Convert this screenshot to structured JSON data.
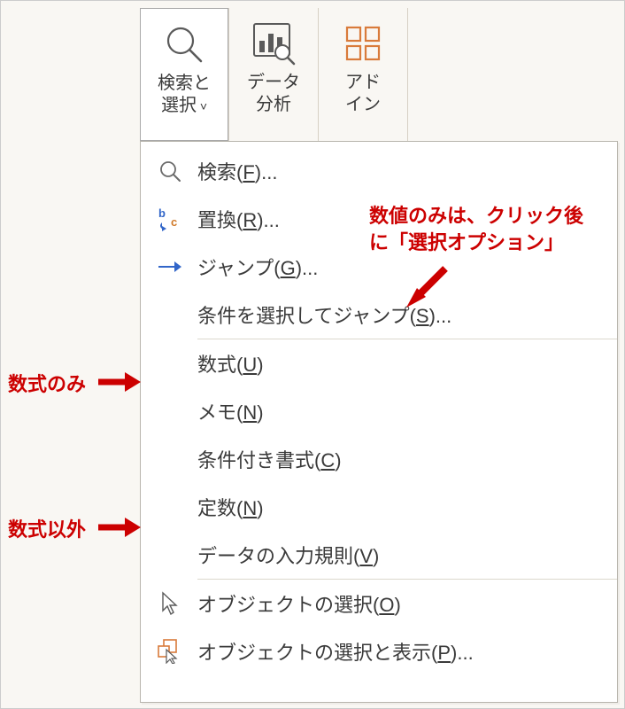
{
  "ribbon": {
    "find_select": {
      "line1": "検索と",
      "line2": "選択"
    },
    "data_analysis": {
      "line1": "データ",
      "line2": "分析"
    },
    "addins": {
      "line1": "アド",
      "line2": "イン"
    }
  },
  "menu": {
    "find": "検索(",
    "find_key": "F",
    "find_suffix": ")...",
    "replace": "置換(",
    "replace_key": "R",
    "replace_suffix": ")...",
    "goto": "ジャンプ(",
    "goto_key": "G",
    "goto_suffix": ")...",
    "goto_special": "条件を選択してジャンプ(",
    "goto_special_key": "S",
    "goto_special_suffix": ")...",
    "formulas": "数式(",
    "formulas_key": "U",
    "formulas_suffix": ")",
    "notes": "メモ(",
    "notes_key": "N",
    "notes_suffix": ")",
    "cond_format": "条件付き書式(",
    "cond_format_key": "C",
    "cond_format_suffix": ")",
    "constants": "定数(",
    "constants_key": "N",
    "constants_suffix": ")",
    "data_valid": "データの入力規則(",
    "data_valid_key": "V",
    "data_valid_suffix": ")",
    "select_obj": "オブジェクトの選択(",
    "select_obj_key": "O",
    "select_obj_suffix": ")",
    "selection_pane": "オブジェクトの選択と表示(",
    "selection_pane_key": "P",
    "selection_pane_suffix": ")..."
  },
  "annotations": {
    "left1": "数式のみ",
    "left2": "数式以外",
    "right_line1": "数値のみは、クリック後",
    "right_line2": "に「選択オプション」"
  }
}
